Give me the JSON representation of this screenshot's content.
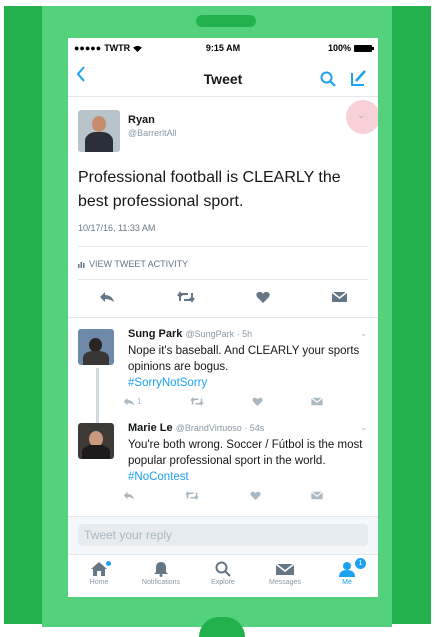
{
  "status_bar": {
    "carrier": "TWTR",
    "time": "9:15 AM",
    "battery": "100%"
  },
  "nav": {
    "title": "Tweet"
  },
  "main_tweet": {
    "name": "Ryan",
    "handle": "@BarrerltAll",
    "text": "Professional football is CLEARLY the best professional sport.",
    "timestamp": "10/17/16, 11:33 AM",
    "activity_label": "VIEW TWEET ACTIVITY"
  },
  "replies": [
    {
      "name": "Sung Park",
      "handle": "@SungPark",
      "time": "5h",
      "text": "Nope it's baseball. And CLEARLY your sports opinions are bogus.",
      "hashtag": "#SorryNotSorry",
      "reply_count": "1"
    },
    {
      "name": "Marie Le",
      "handle": "@BrandVirtuoso",
      "time": "54s",
      "text": "You're both wrong. Soccer / Fútbol is the most popular professional sport in the world.",
      "hashtag": "#NoContest",
      "reply_count": ""
    }
  ],
  "reply_input": {
    "placeholder": "Tweet your reply"
  },
  "tabs": [
    {
      "label": "Home",
      "icon": "home-icon"
    },
    {
      "label": "Notifications",
      "icon": "bell-icon"
    },
    {
      "label": "Explore",
      "icon": "search-icon"
    },
    {
      "label": "Messages",
      "icon": "envelope-icon"
    },
    {
      "label": "Me",
      "icon": "person-icon",
      "badge": "1"
    }
  ],
  "colors": {
    "accent": "#1da1f2",
    "frame": "#23b14d",
    "phone": "#53d17d"
  }
}
